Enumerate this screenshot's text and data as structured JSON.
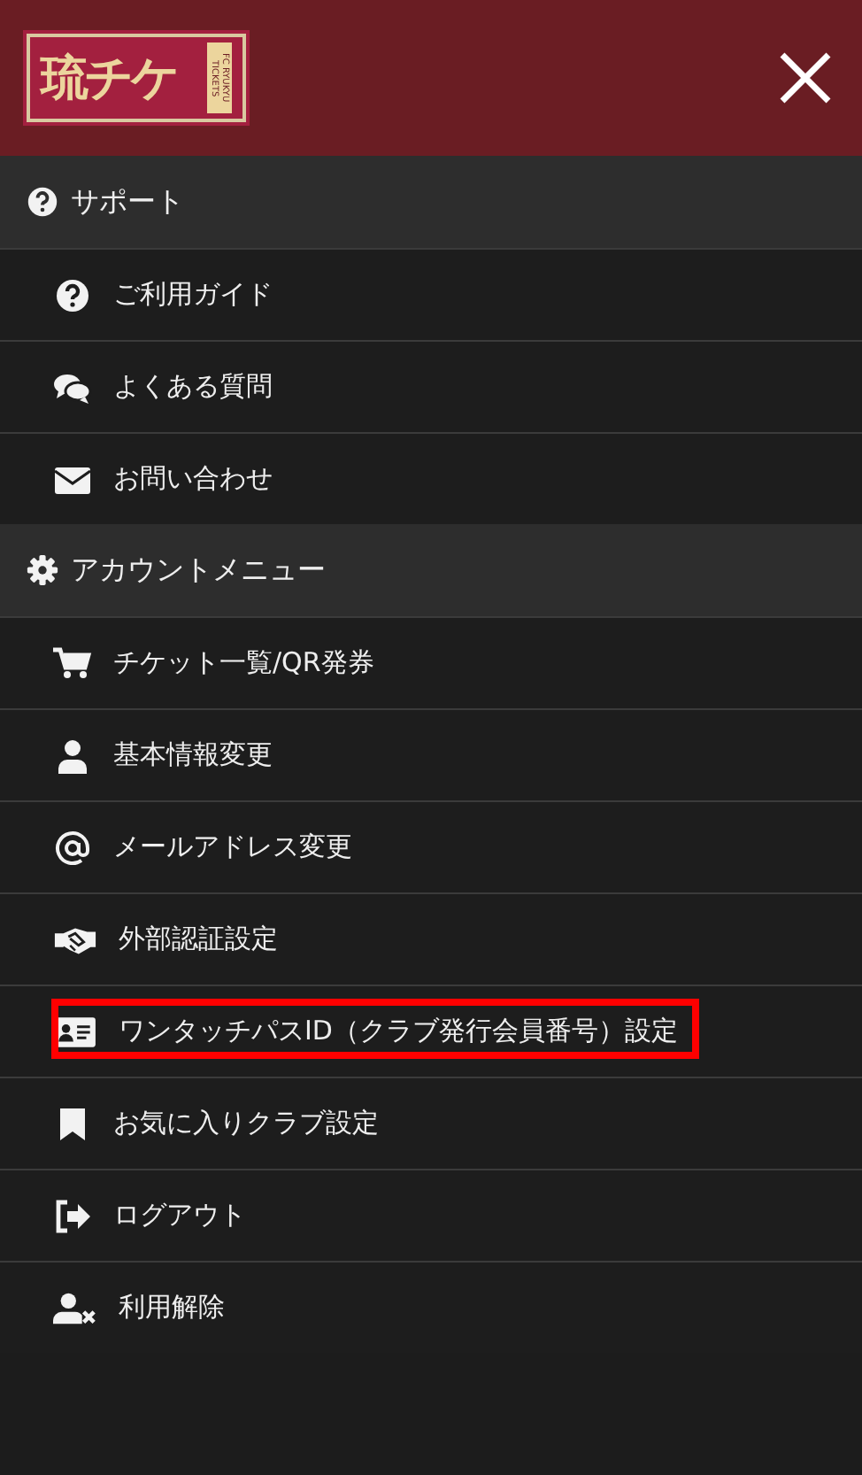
{
  "menu": {
    "logo": {
      "title": "琉チケ",
      "subtitle": "FC RYUKYU TICKETS"
    },
    "sections": [
      {
        "title": "サポート",
        "items": [
          {
            "label": "ご利用ガイド",
            "highlighted": false
          },
          {
            "label": "よくある質問",
            "highlighted": false
          },
          {
            "label": "お問い合わせ",
            "highlighted": false
          }
        ]
      },
      {
        "title": "アカウントメニュー",
        "items": [
          {
            "label": "チケット一覧/QR発券",
            "highlighted": false
          },
          {
            "label": "基本情報変更",
            "highlighted": false
          },
          {
            "label": "メールアドレス変更",
            "highlighted": false
          },
          {
            "label": "外部認証設定",
            "highlighted": false
          },
          {
            "label": "ワンタッチパスID（クラブ発行会員番号）設定",
            "highlighted": true
          },
          {
            "label": "お気に入りクラブ設定",
            "highlighted": false
          },
          {
            "label": "ログアウト",
            "highlighted": false
          },
          {
            "label": "利用解除",
            "highlighted": false
          }
        ]
      }
    ]
  }
}
